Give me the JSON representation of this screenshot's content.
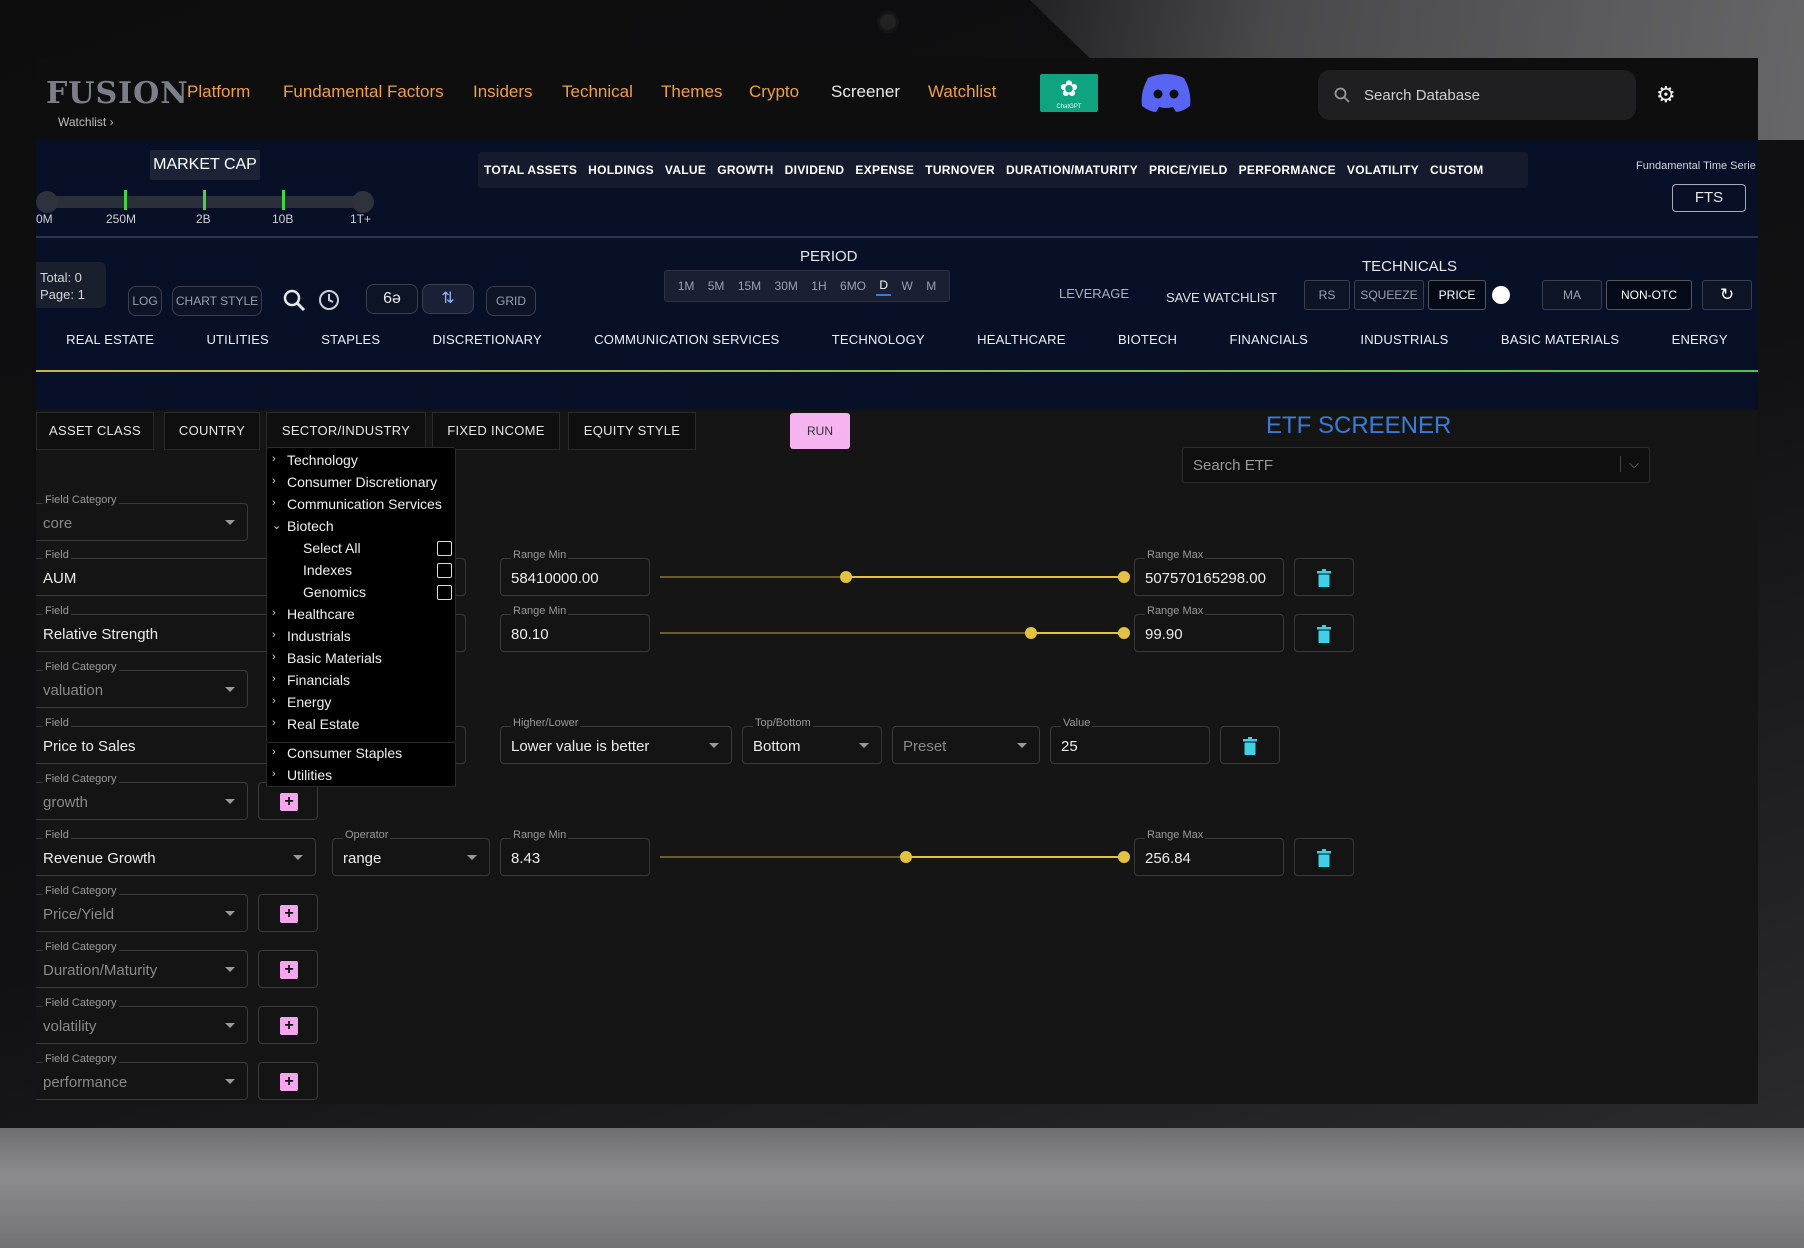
{
  "nav": {
    "logo": "FUSION",
    "breadcrumb": "Watchlist",
    "items": [
      "Platform",
      "Fundamental Factors",
      "Insiders",
      "Technical",
      "Themes",
      "Crypto",
      "Screener",
      "Watchlist"
    ],
    "chatgpt_label": "ChatGPT",
    "search_placeholder": "Search Database",
    "accent_color": "#f0a044"
  },
  "band": {
    "market_cap_label": "MARKET CAP",
    "market_cap_ticks": [
      "0M",
      "250M",
      "2B",
      "10B",
      "1T+"
    ],
    "categories": [
      "TOTAL ASSETS",
      "HOLDINGS",
      "VALUE",
      "GROWTH",
      "DIVIDEND",
      "EXPENSE",
      "TURNOVER",
      "DURATION/MATURITY",
      "PRICE/YIELD",
      "PERFORMANCE",
      "VOLATILITY",
      "CUSTOM"
    ],
    "fts_label": "Fundamental Time Serie",
    "fts_button": "FTS",
    "total": "Total: 0",
    "page": "Page: 1",
    "log": "LOG",
    "chart_style": "CHART STYLE",
    "grid": "GRID",
    "period_label": "PERIOD",
    "periods": [
      "1M",
      "5M",
      "15M",
      "30M",
      "1H",
      "6MO",
      "D",
      "W",
      "M"
    ],
    "active_period": "D",
    "leverage": "LEVERAGE",
    "save_watchlist": "SAVE WATCHLIST",
    "technicals_label": "TECHNICALS",
    "rs": "RS",
    "squeeze": "SQUEEZE",
    "price": "PRICE",
    "ma": "MA",
    "non_otc": "NON-OTC"
  },
  "sectors": [
    "REAL ESTATE",
    "UTILITIES",
    "STAPLES",
    "DISCRETIONARY",
    "COMMUNICATION SERVICES",
    "TECHNOLOGY",
    "HEALTHCARE",
    "BIOTECH",
    "FINANCIALS",
    "INDUSTRIALS",
    "BASIC MATERIALS",
    "ENERGY"
  ],
  "filters": {
    "tabs": [
      "ASSET CLASS",
      "COUNTRY",
      "SECTOR/INDUSTRY",
      "FIXED INCOME",
      "EQUITY STYLE"
    ],
    "run": "RUN",
    "title": "ETF SCREENER",
    "search_placeholder": "Search ETF"
  },
  "tree": {
    "top": [
      "Technology",
      "Consumer Discretionary",
      "Communication Services",
      "Biotech"
    ],
    "biotech_children": [
      "Select All",
      "Indexes",
      "Genomics"
    ],
    "rest": [
      "Healthcare",
      "Industrials",
      "Basic Materials",
      "Financials",
      "Energy",
      "Real Estate",
      "Consumer Staples",
      "Utilities"
    ]
  },
  "form": {
    "field_category_label": "Field Category",
    "field_label": "Field",
    "range_min_label": "Range Min",
    "range_max_label": "Range Max",
    "operator_label": "Operator",
    "higher_lower_label": "Higher/Lower",
    "top_bottom_label": "Top/Bottom",
    "value_label": "Value",
    "categories": [
      "core",
      "valuation",
      "growth",
      "Price/Yield",
      "Duration/Maturity",
      "volatility",
      "performance"
    ],
    "aum": {
      "field": "AUM",
      "min": "58410000.00",
      "max": "507570165298.00",
      "slider_fraction": 0.4
    },
    "rs": {
      "field": "Relative Strength",
      "min": "80.10",
      "max": "99.90",
      "slider_fraction": 0.8
    },
    "pts": {
      "field": "Price to Sales",
      "higher_lower": "Lower value is better",
      "top_bottom": "Bottom",
      "preset": "Preset",
      "value": "25"
    },
    "rev": {
      "field": "Revenue Growth",
      "operator": "range",
      "min": "8.43",
      "max": "256.84",
      "slider_fraction": 0.53
    }
  }
}
